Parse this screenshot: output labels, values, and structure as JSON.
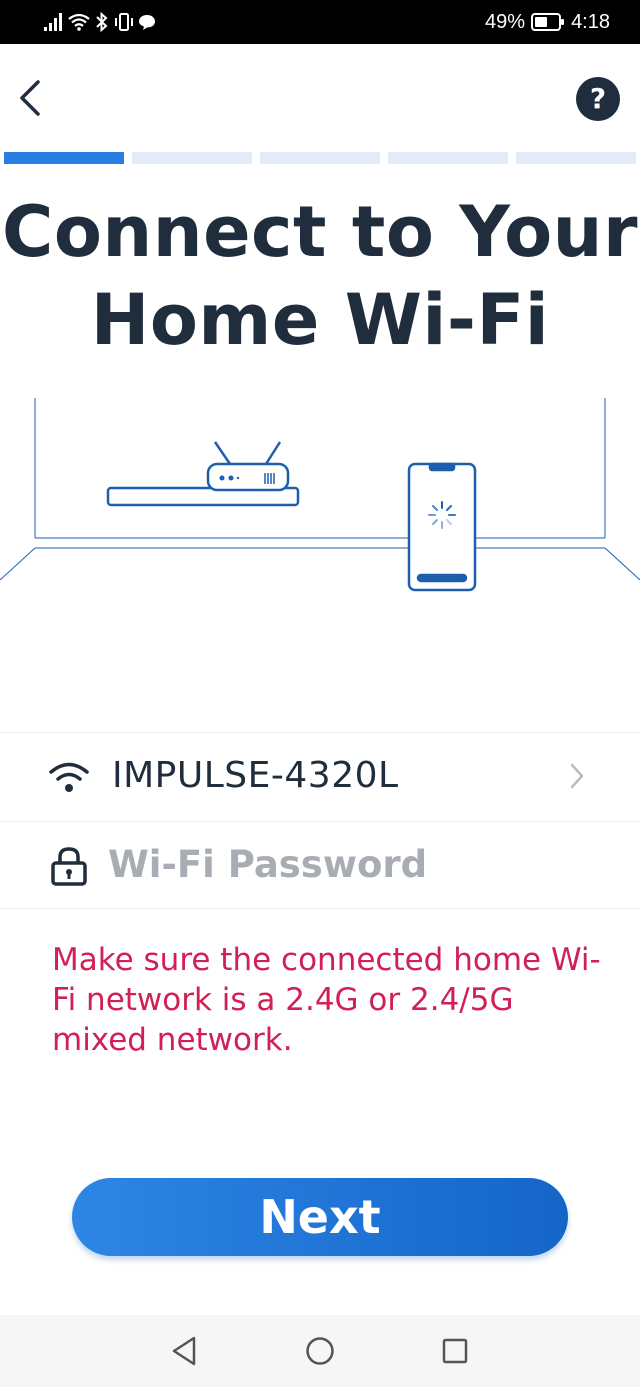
{
  "status_bar": {
    "battery_percent": "49%",
    "time": "4:18",
    "icons": [
      "signal-icon",
      "wifi-icon",
      "bluetooth-icon",
      "vibrate-icon",
      "chat-bubble-icon",
      "battery-icon"
    ]
  },
  "header": {
    "back_icon": "chevron-left-icon",
    "help_label": "?"
  },
  "progress": {
    "total_steps": 5,
    "current_step": 1
  },
  "title": "Connect to Your Home Wi-Fi",
  "network": {
    "ssid": "IMPULSE-4320L",
    "icon": "wifi-icon",
    "chevron": "chevron-right-icon"
  },
  "password": {
    "placeholder": "Wi-Fi Password",
    "value": "",
    "icon": "lock-icon"
  },
  "warning": "Make sure the connected home Wi-Fi network is a 2.4G or 2.4/5G mixed network.",
  "next_button": "Next",
  "nav_bar": {
    "icons": [
      "back-triangle-icon",
      "home-circle-icon",
      "recents-square-icon"
    ]
  },
  "colors": {
    "accent": "#2a7de1",
    "title": "#1f2d3d",
    "warning": "#d21f55",
    "placeholder": "#a8adb3"
  }
}
